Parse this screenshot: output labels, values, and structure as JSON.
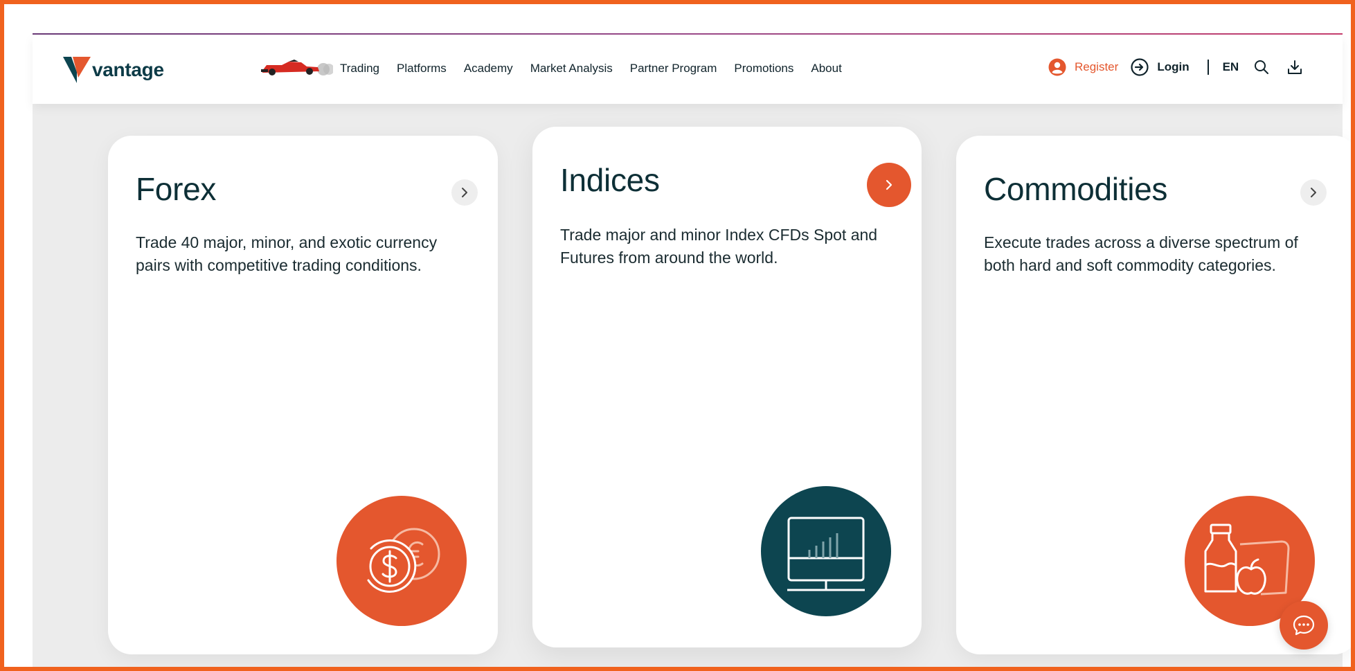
{
  "brand": {
    "name": "vantage"
  },
  "nav": {
    "items": [
      "Trading",
      "Platforms",
      "Academy",
      "Market Analysis",
      "Partner Program",
      "Promotions",
      "About"
    ],
    "register": "Register",
    "login": "Login",
    "language": "EN"
  },
  "cards": [
    {
      "title": "Forex",
      "description": "Trade 40 major, minor, and exotic currency pairs with competitive trading conditions.",
      "icon": "currency-coins-icon"
    },
    {
      "title": "Indices",
      "description": "Trade major and minor Index CFDs Spot and Futures from around the world.",
      "icon": "monitor-chart-icon"
    },
    {
      "title": "Commodities",
      "description": "Execute trades across a diverse spectrum of both hard and soft commodity categories.",
      "icon": "commodity-goods-icon"
    }
  ],
  "colors": {
    "accent": "#e4572e",
    "dark_teal": "#0d4550",
    "text": "#10232b",
    "frame": "#f0621e"
  }
}
